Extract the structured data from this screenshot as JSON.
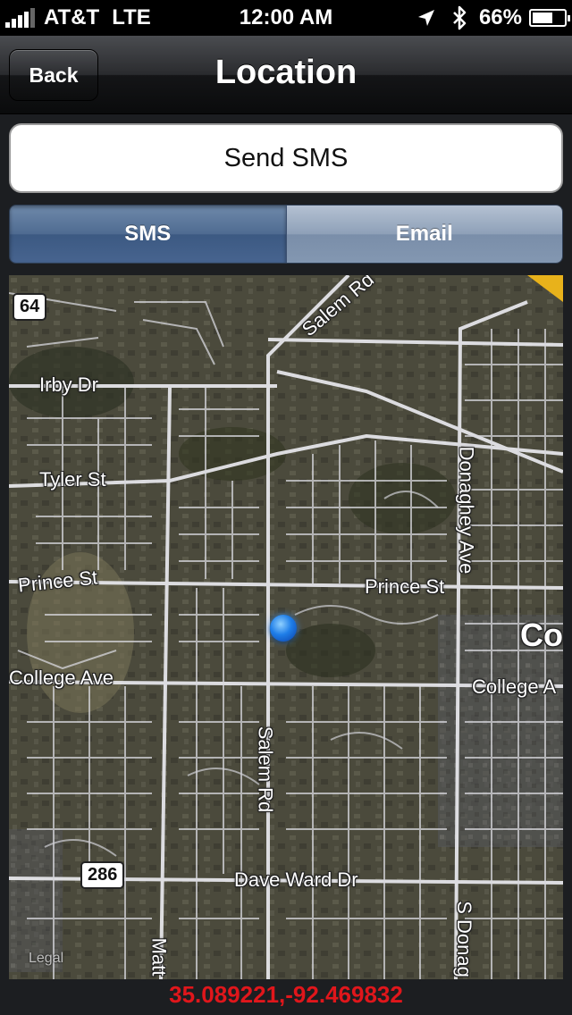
{
  "status_bar": {
    "carrier": "AT&T",
    "network": "LTE",
    "time": "12:00 AM",
    "battery": "66%",
    "battery_level": 0.66,
    "icons": [
      "signal-bars-icon",
      "location-arrow-icon",
      "bluetooth-icon",
      "battery-icon"
    ]
  },
  "nav": {
    "back_label": "Back",
    "title": "Location"
  },
  "send_button_label": "Send SMS",
  "segments": {
    "sms_label": "SMS",
    "email_label": "Email",
    "selected": "SMS"
  },
  "map": {
    "labels": {
      "salem_rd_top": "Salem Rd",
      "irby_dr": "Irby Dr",
      "tyler_st": "Tyler St",
      "prince_st_left": "Prince St",
      "prince_st_right": "Prince St",
      "college_ave_left": "College Ave",
      "college_ave_right": "College A",
      "donaghey_ave": "Donaghey Ave",
      "salem_rd": "Salem Rd",
      "dave_ward_dr": "Dave Ward Dr",
      "s_donaghey": "S Donag",
      "matt": "Matt",
      "city": "Co"
    },
    "shields": {
      "us_64": "64",
      "hwy_286": "286"
    },
    "legal": "Legal"
  },
  "coordinates": "35.089221,-92.469832",
  "colors": {
    "coords": "#e0161b",
    "segment_selected": "#4f6b91",
    "segment_unselected": "#8ea0b8"
  }
}
